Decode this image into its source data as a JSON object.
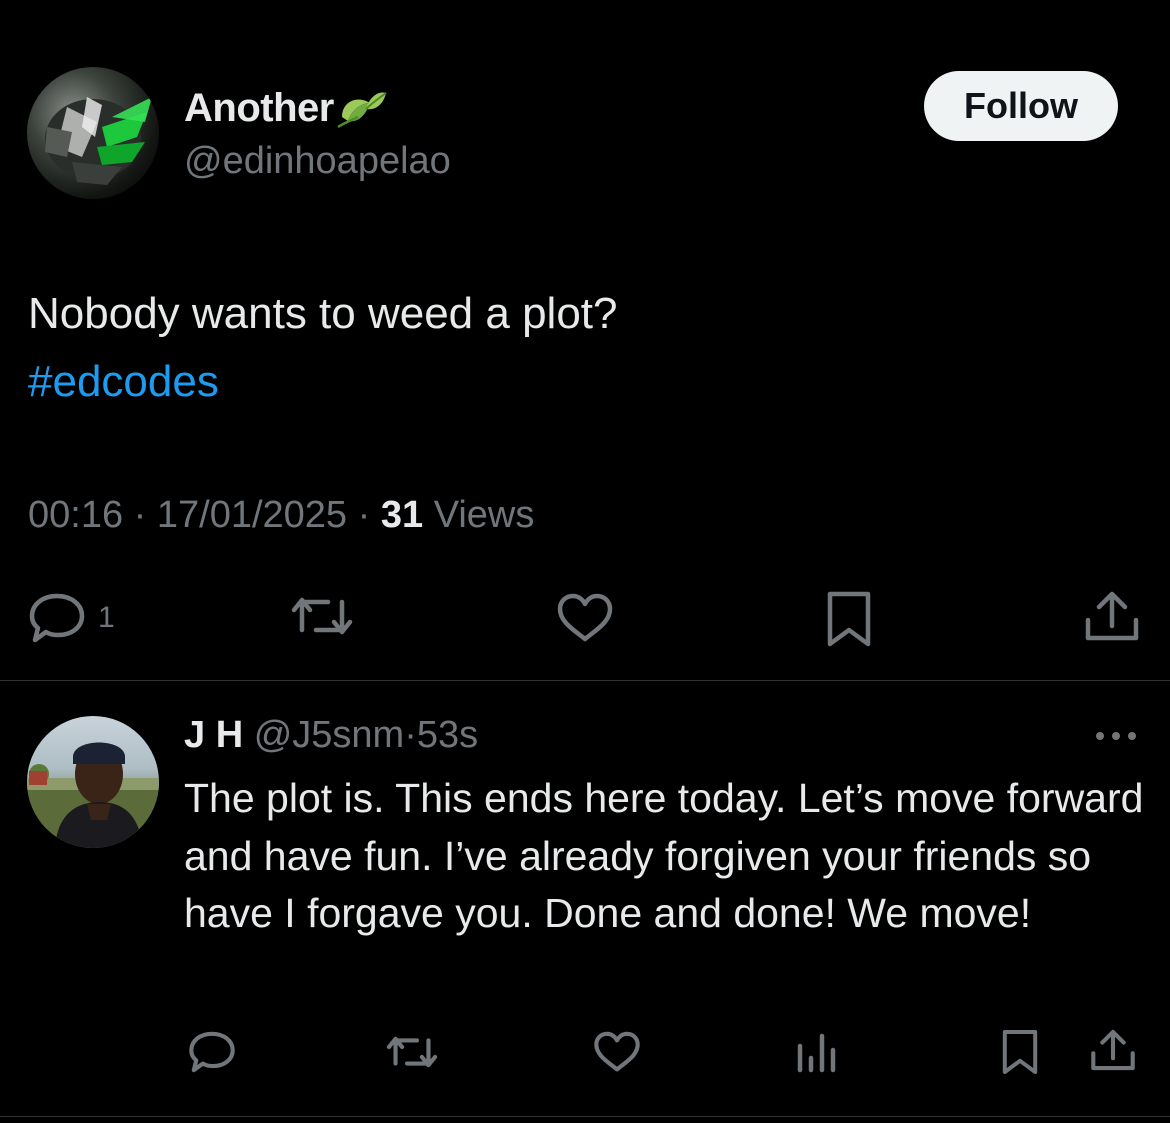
{
  "tweet": {
    "author": {
      "display_name": "Another",
      "emoji_icon": "leaf-icon",
      "handle": "@edinhoapelao"
    },
    "follow_label": "Follow",
    "text_line": "Nobody wants to weed a plot?",
    "hashtag": "#edcodes",
    "time": "00:16",
    "date": "17/01/2025",
    "separator": "·",
    "views_count": "31",
    "views_label": "Views",
    "actions": {
      "reply_count": "1",
      "icons": [
        "reply-icon",
        "retweet-icon",
        "like-icon",
        "bookmark-icon",
        "share-icon"
      ]
    }
  },
  "reply": {
    "author": {
      "display_name": "J H",
      "handle": "@J5snm",
      "separator": "·",
      "time": "53s"
    },
    "text": "The plot is. This ends here today. Let’s move forward and have fun. I’ve already forgiven your friends so have I forgave you. Done and done! We move!",
    "actions": {
      "icons": [
        "reply-icon",
        "retweet-icon",
        "like-icon",
        "analytics-icon",
        "bookmark-icon",
        "share-icon"
      ]
    }
  },
  "colors": {
    "background": "#000000",
    "text_primary": "#e7e9ea",
    "text_secondary": "#71767b",
    "link": "#1d9bf0",
    "divider": "#2f3336",
    "follow_button_bg": "#eff3f4"
  }
}
